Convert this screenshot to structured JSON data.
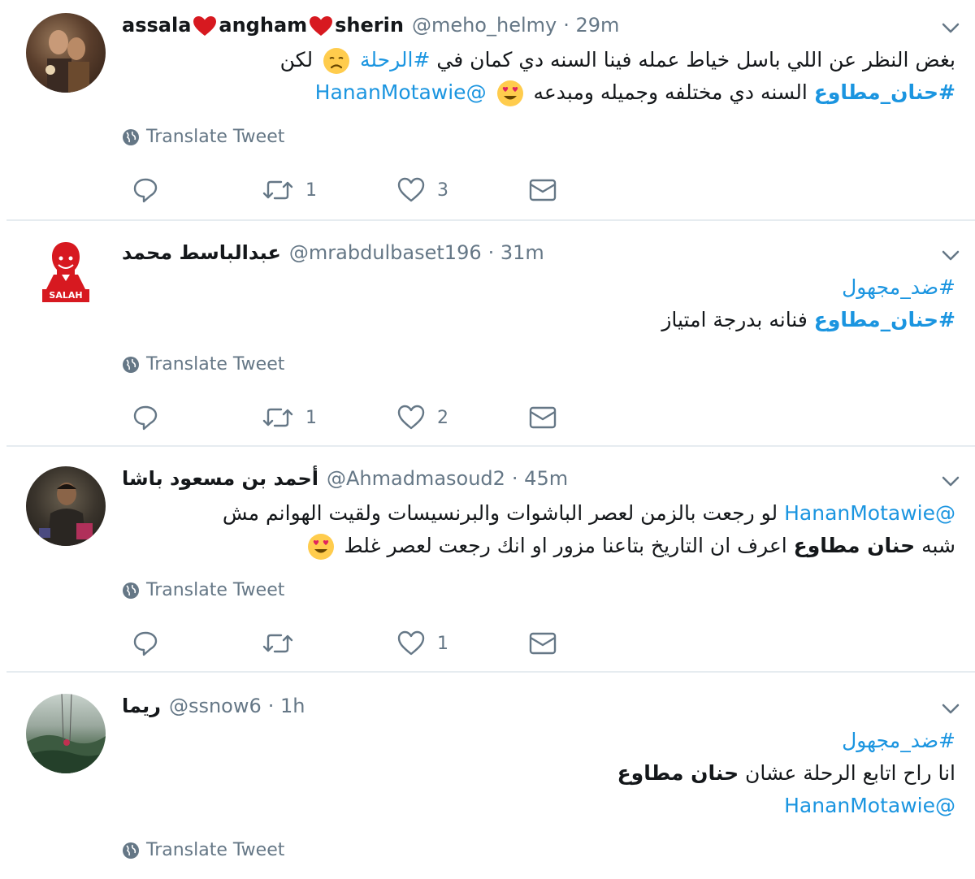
{
  "translate_label": "Translate Tweet",
  "tweets": [
    {
      "name_parts": [
        "assala",
        "angham",
        "sherin"
      ],
      "handle": "@meho_helmy",
      "time": "· 29m",
      "lines": [
        {
          "segments": [
            {
              "text": "بغض النظر عن اللي باسل خياط عمله فينا السنه دي كمان في ",
              "style": "plain"
            },
            {
              "text": "#الرحلة",
              "style": "link"
            },
            {
              "text": " ",
              "style": "plain"
            },
            {
              "emoji": "disappointed-emoji"
            },
            {
              "text": " لكن",
              "style": "plain"
            }
          ]
        },
        {
          "segments": [
            {
              "text": "#حنان_مطاوع",
              "style": "link-bold"
            },
            {
              "text": " السنه دي مختلفه وجميله ومبدعه ",
              "style": "plain"
            },
            {
              "emoji": "heart-eyes-emoji"
            },
            {
              "text": " ",
              "style": "plain"
            },
            {
              "text": "@HananMotawie",
              "style": "link"
            }
          ]
        }
      ],
      "replies": "",
      "retweets": "1",
      "likes": "3",
      "avatar": "photo-avatar-couple"
    },
    {
      "name_parts": [
        "عبدالباسط محمد"
      ],
      "handle": "@mrabdulbaset196",
      "time": "· 31m",
      "lines": [
        {
          "segments": [
            {
              "text": "#ضد_مجهول",
              "style": "link"
            }
          ]
        },
        {
          "segments": [
            {
              "text": "#حنان_مطاوع",
              "style": "link-bold"
            },
            {
              "text": " فنانه بدرجة امتياز",
              "style": "plain"
            }
          ]
        }
      ],
      "replies": "",
      "retweets": "1",
      "likes": "2",
      "avatar": "salah-avatar",
      "avatar_text": "SALAH"
    },
    {
      "name_parts": [
        "أحمد بن مسعود باشا"
      ],
      "handle": "@Ahmadmasoud2",
      "time": "· 45m",
      "lines": [
        {
          "segments": [
            {
              "text": "@HananMotawie",
              "style": "link"
            },
            {
              "text": " لو رجعت بالزمن لعصر الباشوات والبرنسيسات ولقيت الهوانم مش",
              "style": "plain"
            }
          ]
        },
        {
          "segments": [
            {
              "text": "شبه ",
              "style": "plain"
            },
            {
              "text": "حنان مطاوع",
              "style": "bold"
            },
            {
              "text": " اعرف ان التاريخ بتاعنا مزور او انك رجعت لعصر غلط ",
              "style": "plain"
            },
            {
              "emoji": "heart-eyes-emoji"
            }
          ]
        }
      ],
      "replies": "",
      "retweets": "",
      "likes": "1",
      "avatar": "photo-avatar-man"
    },
    {
      "name_parts": [
        "ريما"
      ],
      "handle": "@ssnow6",
      "time": "· 1h",
      "lines": [
        {
          "segments": [
            {
              "text": "#ضد_مجهول",
              "style": "link"
            }
          ]
        },
        {
          "segments": [
            {
              "text": "انا راح اتابع الرحلة عشان ",
              "style": "plain"
            },
            {
              "text": "حنان مطاوع",
              "style": "bold"
            }
          ]
        },
        {
          "segments": [
            {
              "text": "@HananMotawie",
              "style": "link"
            }
          ]
        }
      ],
      "avatar": "photo-avatar-landscape"
    }
  ]
}
